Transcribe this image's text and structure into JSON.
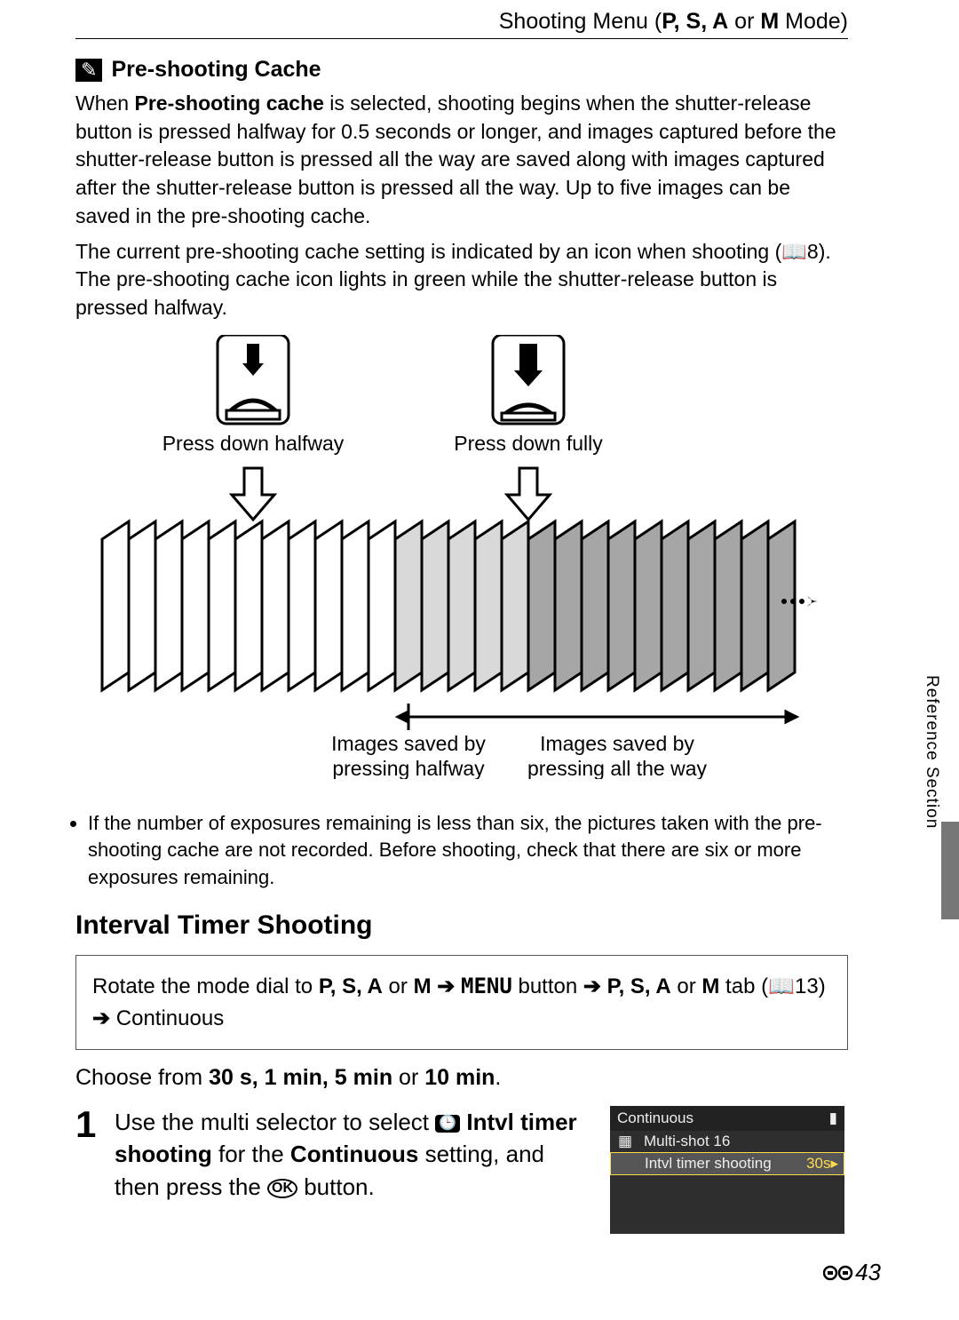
{
  "header": {
    "prefix": "Shooting Menu (",
    "modes": "P, S, A",
    "or": " or ",
    "lastMode": "M",
    "suffix": " Mode)"
  },
  "preshoot": {
    "title": "Pre-shooting Cache",
    "p1a": "When ",
    "p1b": "Pre-shooting cache",
    "p1c": " is selected, shooting begins when the shutter-release button is pressed halfway for 0.5 seconds or longer, and images captured before the shutter-release button is pressed all the way are saved along with images captured after the shutter-release button is pressed all the way. Up to five images can be saved in the pre-shooting cache.",
    "p2a": "The current pre-shooting cache setting is indicated by an icon when shooting (",
    "p2book": "📖",
    "p2page": "8",
    "p2b": "). The pre-shooting cache icon lights in green while the shutter-release button is pressed halfway.",
    "diag": {
      "halfway": "Press down halfway",
      "fully": "Press down fully",
      "savedHalf": "Images saved by pressing halfway",
      "savedFull": "Images saved by pressing all the way"
    },
    "bullet1": "If the number of exposures remaining is less than six, the pictures taken with the pre-shooting cache are not recorded. Before shooting, check that there are six or more exposures remaining."
  },
  "interval": {
    "heading": "Interval Timer Shooting",
    "nav": {
      "a": "Rotate the mode dial to ",
      "modes1": "P, S, A",
      "or1": " or ",
      "m1": "M",
      "arrow": " ➔ ",
      "menu": "MENU",
      "btn": " button ",
      "modes2": "P, S, A",
      "or2": " or ",
      "m2": "M",
      "tab": " tab (",
      "book": "📖",
      "ref": "13",
      "close": ") ",
      "cont": " Continuous"
    },
    "choose_a": "Choose from ",
    "choose_opts": "30 s, 1 min, 5 min",
    "choose_or": " or ",
    "choose_last": "10 min",
    "choose_dot": ".",
    "step1": {
      "num": "1",
      "t1": "Use the multi selector to select ",
      "iconTitle": "Intvl timer shooting",
      "t2": " for the ",
      "cont": "Continuous",
      "t3": " setting, and then press the ",
      "ok": "OK",
      "t4": " button."
    },
    "lcd": {
      "title": "Continuous",
      "row1": "Multi-shot 16",
      "row2": "Intvl timer shooting",
      "row2v": "30s"
    }
  },
  "sideTab": "Reference Section",
  "pageNum": "43"
}
